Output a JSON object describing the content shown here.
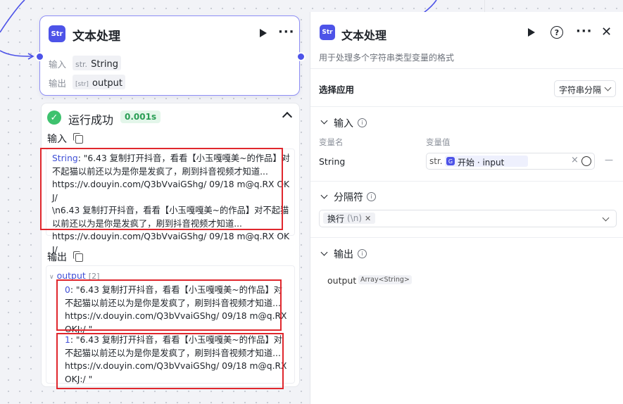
{
  "node": {
    "icon_text": "Str",
    "title": "文本处理",
    "input_label": "输入",
    "input_type_prefix": "str.",
    "input_type": "String",
    "output_label": "输出",
    "output_type_prefix": "[str]",
    "output_name": "output"
  },
  "result": {
    "status": "运行成功",
    "duration": "0.001s",
    "input_heading": "输入",
    "input_key": "String",
    "input_value_lines": [
      ": \"6.43 复制打开抖音，看看【小玉嘎嘎美~的作品】对",
      "不起猫以前还以为是你是发疯了，刷到抖音视频才知道...",
      "https://v.douyin.com/Q3bVvaiGShg/ 09/18 m@q.RX OKJ/",
      "\\n6.43 复制打开抖音，看看【小玉嘎嘎美~的作品】对不起猫",
      "以前还以为是你是发疯了，刷到抖音视频才知道...",
      "https://v.douyin.com/Q3bVvaiGShg/ 09/18 m@q.RX OKJ/",
      "\""
    ],
    "output_heading": "输出",
    "output_key": "output",
    "output_count": "[2]",
    "items": [
      {
        "index": "0",
        "lines": [
          ": \"6.43 复制打开抖音，看看【小玉嘎嘎美~的作品】对",
          "不起猫以前还以为是你是发疯了，刷到抖音视频才知道...",
          "https://v.douyin.com/Q3bVvaiGShg/ 09/18 m@q.RX",
          "OKJ:/ \""
        ]
      },
      {
        "index": "1",
        "lines": [
          ": \"6.43 复制打开抖音，看看【小玉嘎嘎美~的作品】对",
          "不起猫以前还以为是你是发疯了，刷到抖音视频才知道...",
          "https://v.douyin.com/Q3bVvaiGShg/ 09/18 m@q.RX",
          "OKJ:/ \""
        ]
      }
    ]
  },
  "panel": {
    "icon_text": "Str",
    "title": "文本处理",
    "help_symbol": "?",
    "close_symbol": "✕",
    "description": "用于处理多个字符串类型变量的格式",
    "select_app_label": "选择应用",
    "select_app_value": "字符串分隔",
    "input_section": "输入",
    "var_name_col": "变量名",
    "var_value_col": "变量值",
    "var_name": "String",
    "var_ref_prefix": "str.",
    "var_ref_value": "开始 · input",
    "var_ref_clear": "×",
    "var_row_dash": "—",
    "separator_section": "分隔符",
    "separator_tag": "换行",
    "separator_tag_hint": "(\\n)",
    "output_section": "输出",
    "output_name": "output",
    "output_type": "Array<String>"
  },
  "colors": {
    "accent": "#4d53e8",
    "success": "#3ec26e",
    "highlight_box": "#e0272d"
  }
}
